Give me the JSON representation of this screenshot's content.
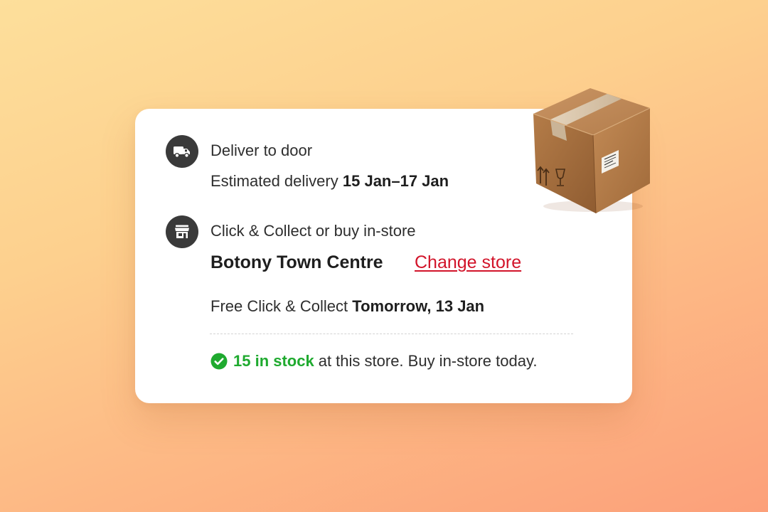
{
  "delivery": {
    "title": "Deliver to door",
    "estimate_prefix": "Estimated delivery",
    "estimate_dates": "15 Jan–17 Jan",
    "icon": "truck-icon"
  },
  "collect": {
    "title": "Click & Collect or buy in-store",
    "store_name": "Botony Town Centre",
    "change_store_label": "Change store",
    "free_prefix": "Free Click & Collect",
    "free_date": "Tomorrow, 13 Jan",
    "icon": "store-icon"
  },
  "stock": {
    "count_label": "15 in stock",
    "message": "at this store. Buy in-store today.",
    "icon": "check-circle-icon",
    "status_color": "#1faa2f"
  },
  "decoration": {
    "icon": "package-box-icon"
  },
  "colors": {
    "link": "#d2142a",
    "icon_bg": "#3a3a3a",
    "in_stock": "#1faa2f"
  }
}
